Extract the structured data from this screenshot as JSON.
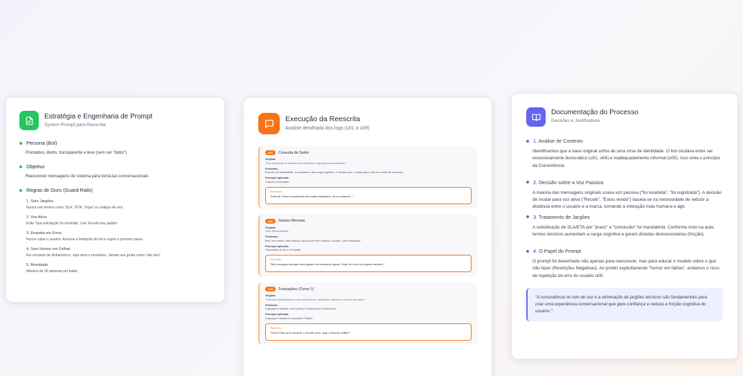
{
  "colors": {
    "green": "#22c55e",
    "orange": "#f97316",
    "indigo": "#6366f1"
  },
  "left": {
    "icon": "document-icon",
    "title": "Estratégia e Engenharia de Prompt",
    "subtitle": "System Prompt para Reescrita",
    "persona_title": "Persona (Bot)",
    "persona_desc": "Prestativo, direto, transparente e leve (sem ser \"bobo\")",
    "objective_title": "Objetivo",
    "objective_desc": "Reescrever mensagens de sistema para torná-las conversacionais",
    "rules_title": "Regras de Ouro (Guard Rails)",
    "rules": [
      {
        "title": "1. Sem Jargões",
        "desc": "Nunca use termos como 'SLA', 'ETA', 'Input' ou códigos de erro"
      },
      {
        "title": "2. Voz Ativa",
        "desc": "Evite 'Sua solicitação foi recebida'. Use 'Recebi seu pedido'"
      },
      {
        "title": "3. Empatia em Erros",
        "desc": "Nunca culpe o usuário. Assuma a limitação do bot e sugira o próximo passo"
      },
      {
        "title": "4. Sem Humor em Falhas",
        "desc": "Em cenários de dinheiro/erro, seja sério e resolutivo. Jamais use gírias como \"não pira\""
      },
      {
        "title": "5. Brevidade",
        "desc": "Máximo de 20 palavras por balão"
      }
    ]
  },
  "middle": {
    "icon": "chat-icon",
    "title": "Execução da Reescrita",
    "subtitle": "Análise detalhada dos logs (u01 a u09)",
    "labels": {
      "original": "Original:",
      "problem": "Problema:",
      "principle": "Princípio Aplicado:",
      "rewrite": "Reescrito:"
    },
    "logs": [
      {
        "tag": "u01",
        "title": "Consulta de Saldo",
        "original": "\"Sua solicitação foi devidamente recebida e aguarda processamento\"",
        "problem": "Excesso de formalidade, voz passiva e alta carga cognitiva. O usuário quer o saldo agora, não um recibo de protocolo.",
        "principle": "Clareza e Brevidade",
        "rewrite": "\"Entendi. Estou consultando seu saldo atualizado, só um instante...\""
      },
      {
        "tag": "u04",
        "title": "Gastos Mensais",
        "original": "\"Erro desconhecido.\"",
        "problem": "Beco sem saída. Não explica o que houve nem orienta o usuário. Gera frustração.",
        "principle": "Tratamento de Erro e Empatia",
        "rewrite": "\"Não consegui carregar seus gastos de transporte agora. Tente de novo em alguns minutos?\""
      },
      {
        "tag": "u05",
        "title": "Transações (Turno 1)",
        "original": "\"Para dar continuidade ao seu atendimento, solicitamos informar o número do cartão.\"",
        "problem": "Linguagem robótica, texto prolixo e impessoal (\"solicitamos\").",
        "principle": "Linguagem Natural e Imperativo Positivo",
        "rewrite": "\"Claro! Para eu te mostrar o recorte certo, qual o final do cartão?\""
      }
    ]
  },
  "right": {
    "icon": "book-icon",
    "title": "Documentação do Processo",
    "subtitle": "Decisões e Justificativas",
    "sections": [
      {
        "title": "1. Análise de Contexto",
        "desc": "Identificamos que a base original sofria de uma crise de identidade. O bot oscilava entre ser excessivamente burocrático (u01, u04) e inadequadamente informal (u05). Isso viola o princípio da Consistência."
      },
      {
        "title": "2. Decisão sobre a Voz Passiva",
        "desc": "A maioria das mensagens originais usava voz passiva (\"foi recebida\", \"foi registrada\"). A decisão de mudar para voz ativa (\"Recebi\", \"Estou vendo\") baseia-se na necessidade de reduzir a distância entre o usuário e a marca, tornando a interação mais humana e ágil."
      },
      {
        "title": "3. Tratamento de Jargões",
        "desc": "A substituição de SLA/ETA por \"prazo\" e \"conclusão\" foi mandatória. Conforme visto na aula, termos técnicos aumentam a carga cognitiva e geram dúvidas desnecessárias (fricção)."
      },
      {
        "title": "4. O Papel do Prompt",
        "desc": "O prompt foi desenhado não apenas para reescrever, mas para educar o modelo sobre o que não fazer (Restrições Negativas). Ao proibir explicitamente \"humor em falhas\", evitamos o risco de repetição do erro do usuário u05."
      }
    ],
    "quote": "\"A consistência no tom de voz e a eliminação de jargões técnicos são fundamentais para criar uma experiência conversacional que gere confiança e reduza a fricção cognitiva do usuário.\""
  }
}
